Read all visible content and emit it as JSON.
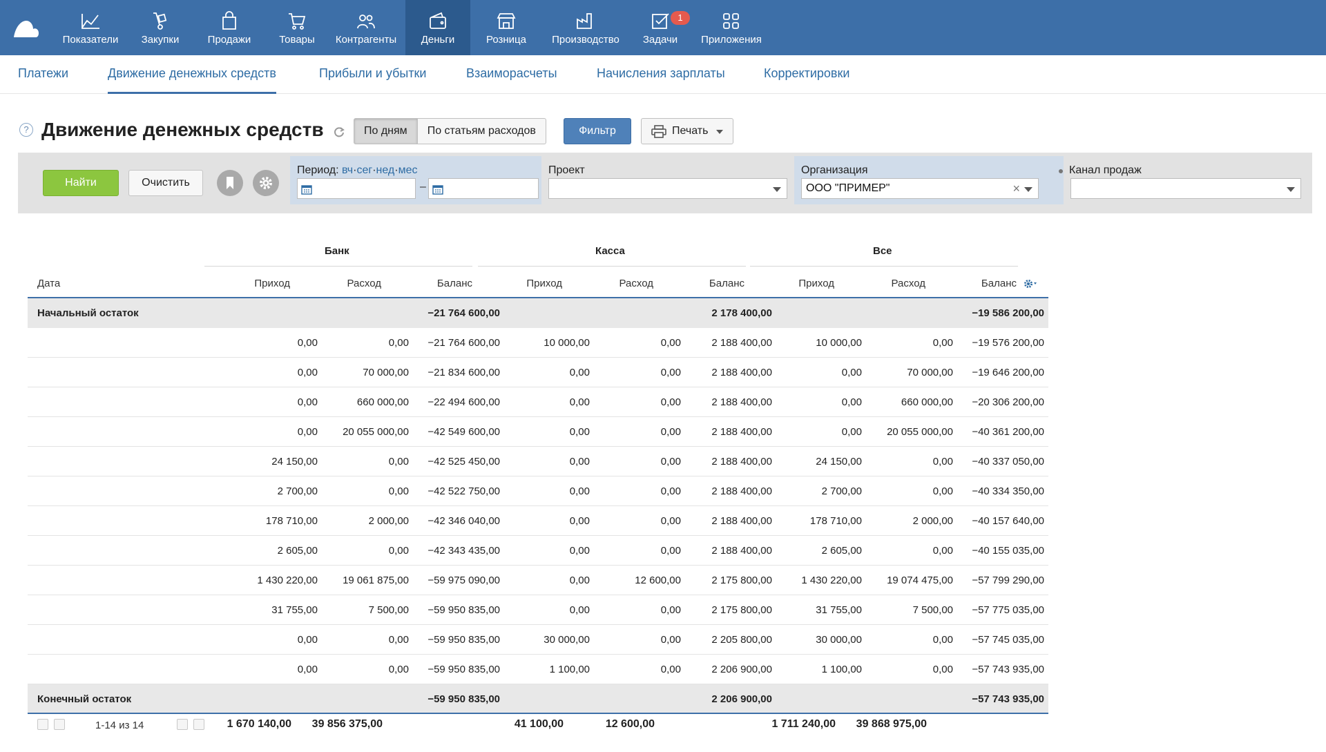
{
  "topnav": {
    "items": [
      {
        "label": "Показатели",
        "icon": "chart-line-icon",
        "active": false
      },
      {
        "label": "Закупки",
        "icon": "hand-truck-icon",
        "active": false
      },
      {
        "label": "Продажи",
        "icon": "shopping-bag-icon",
        "active": false
      },
      {
        "label": "Товары",
        "icon": "cart-icon",
        "active": false
      },
      {
        "label": "Контрагенты",
        "icon": "people-icon",
        "active": false
      },
      {
        "label": "Деньги",
        "icon": "wallet-icon",
        "active": true
      },
      {
        "label": "Розница",
        "icon": "store-icon",
        "active": false
      },
      {
        "label": "Производство",
        "icon": "factory-icon",
        "active": false
      },
      {
        "label": "Задачи",
        "icon": "checkbox-icon",
        "active": false,
        "badge": "1"
      },
      {
        "label": "Приложения",
        "icon": "apps-grid-icon",
        "active": false
      }
    ]
  },
  "subnav": {
    "tabs": [
      {
        "label": "Платежи",
        "active": false
      },
      {
        "label": "Движение денежных средств",
        "active": true
      },
      {
        "label": "Прибыли и убытки",
        "active": false
      },
      {
        "label": "Взаиморасчеты",
        "active": false
      },
      {
        "label": "Начисления зарплаты",
        "active": false
      },
      {
        "label": "Корректировки",
        "active": false
      }
    ]
  },
  "title": {
    "help": "?",
    "text": "Движение денежных средств",
    "by_days": "По дням",
    "by_items": "По статьям расходов",
    "filter": "Фильтр",
    "print": "Печать"
  },
  "filters": {
    "find": "Найти",
    "clear": "Очистить",
    "period_label": "Период:",
    "period_links": [
      "вч",
      "сег",
      "нед",
      "мес"
    ],
    "period_dash": "–",
    "period_from": "",
    "period_to": "",
    "project_label": "Проект",
    "project_value": "",
    "org_label": "Организация",
    "org_value": "ООО \"ПРИМЕР\"",
    "org_clear": "×",
    "channel_label": "Канал продаж",
    "channel_value": ""
  },
  "table": {
    "groups": [
      "Банк",
      "Касса",
      "Все"
    ],
    "columns": [
      "Дата",
      "Приход",
      "Расход",
      "Баланс",
      "Приход",
      "Расход",
      "Баланс",
      "Приход",
      "Расход",
      "Баланс"
    ],
    "opening": {
      "label": "Начальный остаток",
      "values": [
        "",
        "",
        "−21 764 600,00",
        "",
        "",
        "2 178 400,00",
        "",
        "",
        "−19 586 200,00"
      ]
    },
    "rows": [
      [
        "",
        "0,00",
        "0,00",
        "−21 764 600,00",
        "10 000,00",
        "0,00",
        "2 188 400,00",
        "10 000,00",
        "0,00",
        "−19 576 200,00"
      ],
      [
        "",
        "0,00",
        "70 000,00",
        "−21 834 600,00",
        "0,00",
        "0,00",
        "2 188 400,00",
        "0,00",
        "70 000,00",
        "−19 646 200,00"
      ],
      [
        "",
        "0,00",
        "660 000,00",
        "−22 494 600,00",
        "0,00",
        "0,00",
        "2 188 400,00",
        "0,00",
        "660 000,00",
        "−20 306 200,00"
      ],
      [
        "",
        "0,00",
        "20 055 000,00",
        "−42 549 600,00",
        "0,00",
        "0,00",
        "2 188 400,00",
        "0,00",
        "20 055 000,00",
        "−40 361 200,00"
      ],
      [
        "",
        "24 150,00",
        "0,00",
        "−42 525 450,00",
        "0,00",
        "0,00",
        "2 188 400,00",
        "24 150,00",
        "0,00",
        "−40 337 050,00"
      ],
      [
        "",
        "2 700,00",
        "0,00",
        "−42 522 750,00",
        "0,00",
        "0,00",
        "2 188 400,00",
        "2 700,00",
        "0,00",
        "−40 334 350,00"
      ],
      [
        "",
        "178 710,00",
        "2 000,00",
        "−42 346 040,00",
        "0,00",
        "0,00",
        "2 188 400,00",
        "178 710,00",
        "2 000,00",
        "−40 157 640,00"
      ],
      [
        "",
        "2 605,00",
        "0,00",
        "−42 343 435,00",
        "0,00",
        "0,00",
        "2 188 400,00",
        "2 605,00",
        "0,00",
        "−40 155 035,00"
      ],
      [
        "",
        "1 430 220,00",
        "19 061 875,00",
        "−59 975 090,00",
        "0,00",
        "12 600,00",
        "2 175 800,00",
        "1 430 220,00",
        "19 074 475,00",
        "−57 799 290,00"
      ],
      [
        "",
        "31 755,00",
        "7 500,00",
        "−59 950 835,00",
        "0,00",
        "0,00",
        "2 175 800,00",
        "31 755,00",
        "7 500,00",
        "−57 775 035,00"
      ],
      [
        "",
        "0,00",
        "0,00",
        "−59 950 835,00",
        "30 000,00",
        "0,00",
        "2 205 800,00",
        "30 000,00",
        "0,00",
        "−57 745 035,00"
      ],
      [
        "",
        "0,00",
        "0,00",
        "−59 950 835,00",
        "1 100,00",
        "0,00",
        "2 206 900,00",
        "1 100,00",
        "0,00",
        "−57 743 935,00"
      ]
    ],
    "closing": {
      "label": "Конечный остаток",
      "values": [
        "",
        "",
        "−59 950 835,00",
        "",
        "",
        "2 206 900,00",
        "",
        "",
        "−57 743 935,00"
      ]
    },
    "footer": {
      "pager": "1-14 из 14",
      "totals": [
        "1 670 140,00",
        "39 856 375,00",
        "",
        "41 100,00",
        "12 600,00",
        "",
        "1 711 240,00",
        "39 868 975,00",
        ""
      ]
    }
  },
  "colors": {
    "nav": "#3d6fa8",
    "nav_active": "#2c5a8d",
    "accent": "#2e6ca4",
    "find": "#8cc63f",
    "badge": "#e55a4e"
  }
}
